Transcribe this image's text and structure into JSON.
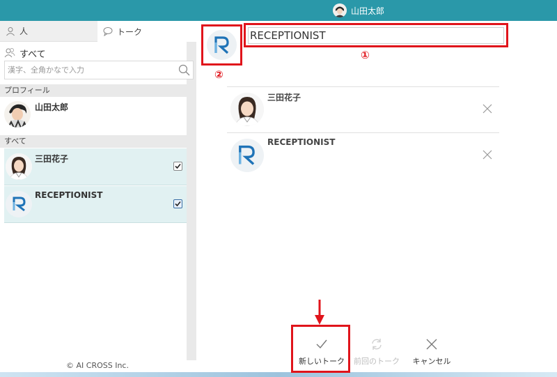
{
  "topbar": {
    "user_name": "山田太郎"
  },
  "sidebar": {
    "tabs": [
      {
        "label": "人"
      },
      {
        "label": "トーク"
      }
    ],
    "filter_label": "すべて",
    "search_placeholder": "漢字、全角かなで入力",
    "profile_section": "プロフィール",
    "profile_name": "山田太郎",
    "all_section": "すべて",
    "contacts": [
      {
        "name": "三田花子",
        "checked": true
      },
      {
        "name": "RECEPTIONIST",
        "checked": true
      }
    ],
    "copyright": "© AI CROSS Inc."
  },
  "main": {
    "talk_title": "RECEPTIONIST",
    "annotation_1": "①",
    "annotation_2": "②",
    "members": [
      {
        "name": "三田花子"
      },
      {
        "name": "RECEPTIONIST"
      }
    ],
    "actions": {
      "new_talk": "新しいトーク",
      "prev_talk": "前回のトーク",
      "cancel": "キャンセル"
    }
  },
  "colors": {
    "accent": "#2a98a9",
    "highlight": "#e0141b",
    "selected_row": "#e1f1f2",
    "brand_blue": "#1f73b7"
  }
}
